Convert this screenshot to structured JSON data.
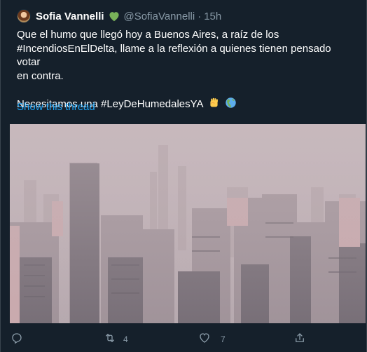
{
  "author": {
    "name": "Sofia Vannelli",
    "badge_icon": "green-heart-icon",
    "handle": "@SofiaVannelli",
    "separator": "·",
    "time": "15h"
  },
  "tweet": {
    "line1": "Que el humo que llegó hoy a Buenos Aires, a raíz de los",
    "line2": "#IncendiosEnElDelta, llame a la reflexión a quienes tienen pensado votar",
    "line3": "en contra.",
    "line4": "Necesitamos una #LeyDeHumedalesYA",
    "emojis": [
      "raised-fist-icon",
      "globe-americas-icon"
    ]
  },
  "thread_link": "Show this thread",
  "media": {
    "description_icon": "smoggy-city-skyline-photo"
  },
  "actions": {
    "reply": {
      "icon": "reply-icon",
      "count": ""
    },
    "retweet": {
      "icon": "retweet-icon",
      "count": "4"
    },
    "like": {
      "icon": "heart-icon",
      "count": "7"
    },
    "share": {
      "icon": "share-icon",
      "count": ""
    }
  },
  "colors": {
    "background": "#15202b",
    "text": "#ffffff",
    "muted": "#8899a6",
    "link": "#1da1f2",
    "badge": "#78b159"
  }
}
